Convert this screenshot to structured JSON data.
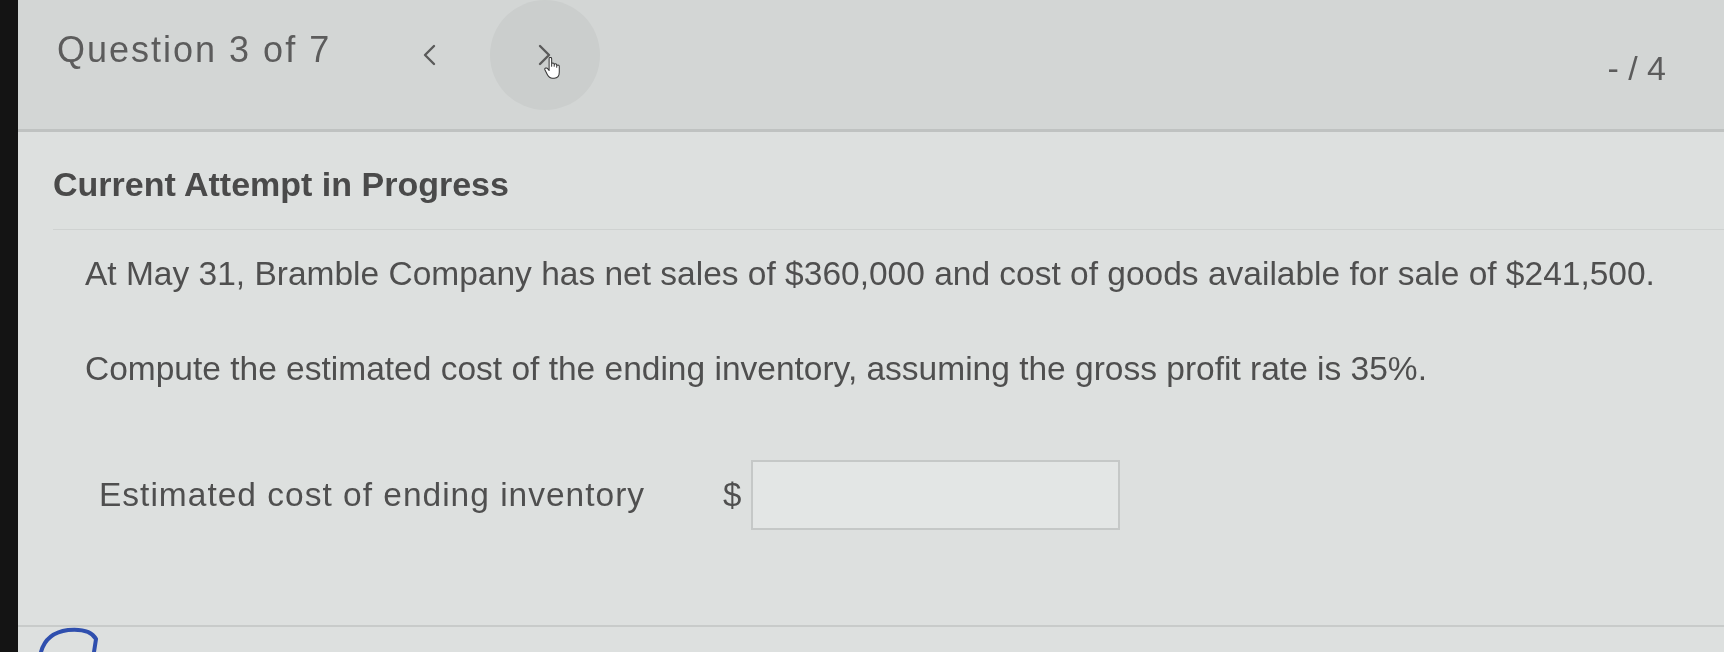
{
  "header": {
    "question_label": "Question 3 of 7",
    "nav_buttons": [
      {
        "kind": "previous",
        "hovered": false
      },
      {
        "kind": "next",
        "hovered": true
      }
    ],
    "score": "- / 4"
  },
  "section_title": "Current Attempt in Progress",
  "question": {
    "paragraphs": [
      "At May 31, Bramble Company has net sales of $360,000 and cost of goods available for sale of $241,500.",
      "Compute the estimated cost of the ending inventory, assuming the gross profit rate is 35%."
    ]
  },
  "answer": {
    "label": "Estimated cost of ending inventory",
    "currency": "$"
  }
}
